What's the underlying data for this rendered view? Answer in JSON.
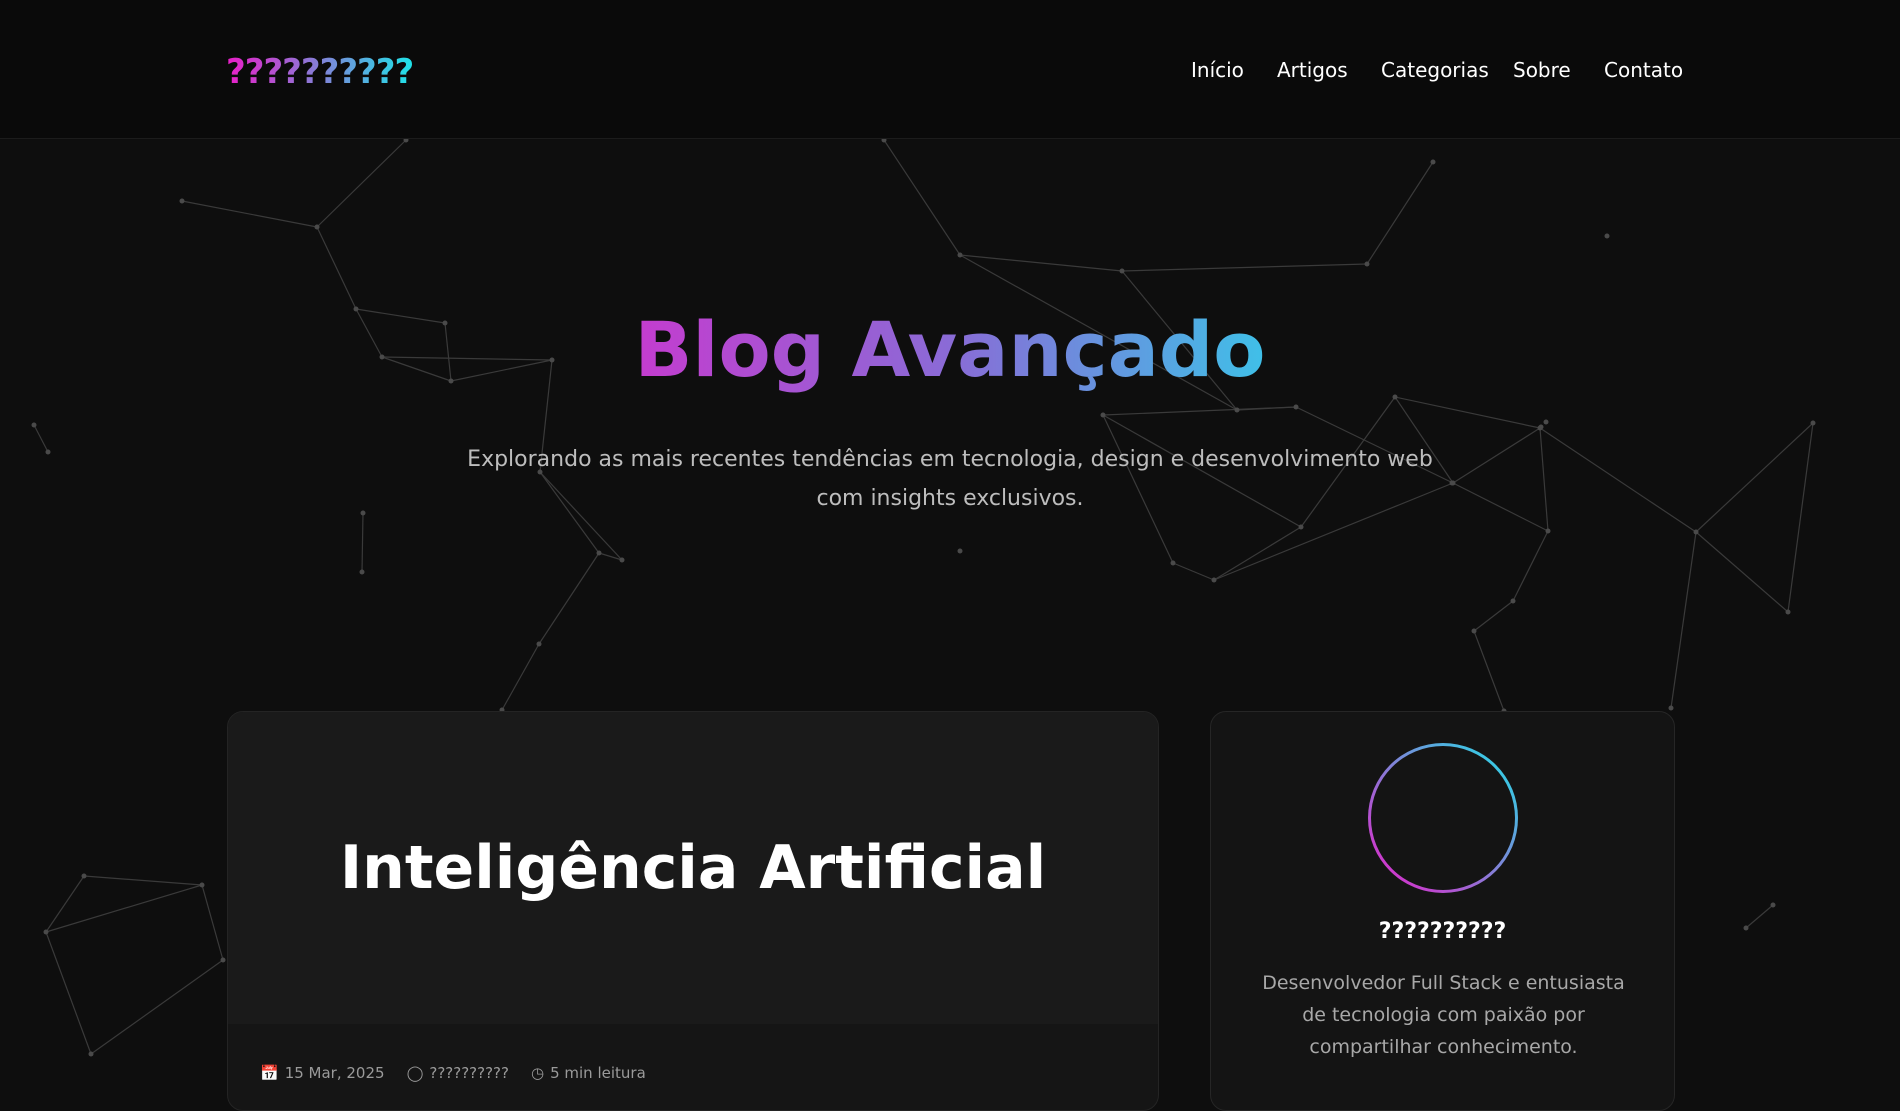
{
  "header": {
    "logo": "??????????",
    "nav": [
      "Início",
      "Artigos",
      "Categorias",
      "Sobre",
      "Contato"
    ]
  },
  "hero": {
    "title": "Blog Avançado",
    "subtitle": "Explorando as mais recentes tendências em tecnologia, design e desenvolvimento web com insights exclusivos."
  },
  "post": {
    "title": "Inteligência Artificial",
    "date": "15 Mar, 2025",
    "author": "??????????",
    "read_time": "5 min leitura"
  },
  "profile": {
    "name": "??????????",
    "bio": "Desenvolvedor Full Stack e entusiasta de tecnologia com paixão por compartilhar conhecimento."
  },
  "colors": {
    "accent_start": "#e91ec8",
    "accent_end": "#1ee3e8"
  }
}
